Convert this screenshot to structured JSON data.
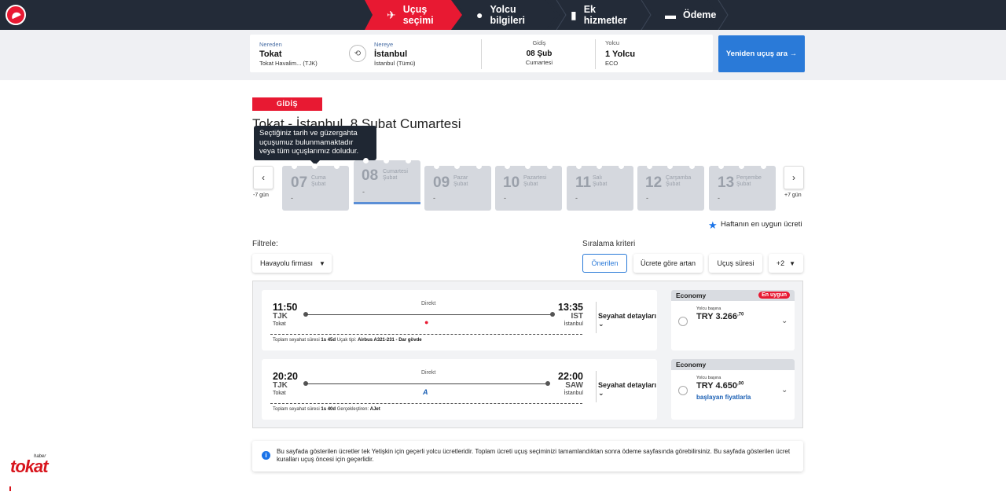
{
  "nav": {
    "steps": [
      {
        "label": "Uçuş seçimi",
        "active": true
      },
      {
        "label": "Yolcu bilgileri",
        "active": false
      },
      {
        "label": "Ek hizmetler",
        "active": false
      },
      {
        "label": "Ödeme",
        "active": false
      }
    ]
  },
  "search": {
    "from_label": "Nereden",
    "from_city": "Tokat",
    "from_airport": "Tokat Havalim...  (TJK)",
    "to_label": "Nereye",
    "to_city": "İstanbul",
    "to_airport": "İstanbul (Tümü)",
    "date_label": "Gidiş",
    "date_value": "08 Şub",
    "date_day": "Cumartesi",
    "pax_label": "Yolcu",
    "pax_value": "1 Yolcu",
    "pax_class": "ECO",
    "button": "Yeniden uçuş ara →"
  },
  "departure": {
    "tag": "GİDİŞ",
    "route_title": "Tokat - İstanbul, 8 Şubat Cumartesi",
    "tooltip": "Seçtiğiniz tarih ve güzergahta uçuşumuz bulunmamaktadır veya tüm uçuşlarımız doludur."
  },
  "dates": {
    "prev_label": "-7 gün",
    "next_label": "+7 gün",
    "items": [
      {
        "day": "07",
        "weekday": "Cuma",
        "month": "Şubat",
        "price": "-"
      },
      {
        "day": "08",
        "weekday": "Cumartesi",
        "month": "Şubat",
        "price": "-"
      },
      {
        "day": "09",
        "weekday": "Pazar",
        "month": "Şubat",
        "price": "-"
      },
      {
        "day": "10",
        "weekday": "Pazartesi",
        "month": "Şubat",
        "price": "-"
      },
      {
        "day": "11",
        "weekday": "Salı",
        "month": "Şubat",
        "price": "-"
      },
      {
        "day": "12",
        "weekday": "Çarşamba",
        "month": "Şubat",
        "price": "-"
      },
      {
        "day": "13",
        "weekday": "Perşembe",
        "month": "Şubat",
        "price": "-"
      }
    ],
    "cheapest_note": "Haftanın en uygun ücreti"
  },
  "filters": {
    "label": "Filtrele:",
    "airline_dropdown": "Havayolu firması",
    "sort_label": "Sıralama kriteri",
    "sort_options": [
      "Önerilen",
      "Ücrete göre artan",
      "Uçuş süresi",
      "+2"
    ]
  },
  "flights": [
    {
      "dep_time": "11:50",
      "dep_code": "TJK",
      "dep_city": "Tokat",
      "arr_time": "13:35",
      "arr_code": "IST",
      "arr_city": "İstanbul",
      "type": "Direkt",
      "info_label1": "Toplam seyahat süresi",
      "duration": "1s 45d",
      "info_label2": "Uçak tipi:",
      "aircraft": "Airbus A321-231 - Dar gövde",
      "details": "Seyahat detayları",
      "fare_class": "Economy",
      "badge": "En uygun",
      "per_pax": "Yolcu başına",
      "price": "TRY 3.266",
      "price_dec": ",70",
      "from_note": ""
    },
    {
      "dep_time": "20:20",
      "dep_code": "TJK",
      "dep_city": "Tokat",
      "arr_time": "22:00",
      "arr_code": "SAW",
      "arr_city": "İstanbul",
      "type": "Direkt",
      "info_label1": "Toplam seyahat süresi",
      "duration": "1s 40d",
      "info_label2": "Gerçekleştiren:",
      "aircraft": "AJet",
      "details": "Seyahat detayları",
      "fare_class": "Economy",
      "badge": "",
      "per_pax": "Yolcu başına",
      "price": "TRY 4.650",
      "price_dec": ",00",
      "from_note": "başlayan fiyatlarla"
    }
  ],
  "notice": "Bu sayfada gösterilen ücretler tek Yetişkin için geçerli yolcu ücretleridir. Toplam ücreti uçuş seçiminizi tamamlandıktan sonra ödeme sayfasında görebilirsiniz. Bu sayfada gösterilen ücret kuralları uçuş öncesi için geçerlidir.",
  "watermark": {
    "small": "haber",
    "big": "tokat"
  },
  "colors": {
    "brand_red": "#e81932",
    "nav_dark": "#232b38",
    "accent_blue": "#2a7ad8"
  }
}
